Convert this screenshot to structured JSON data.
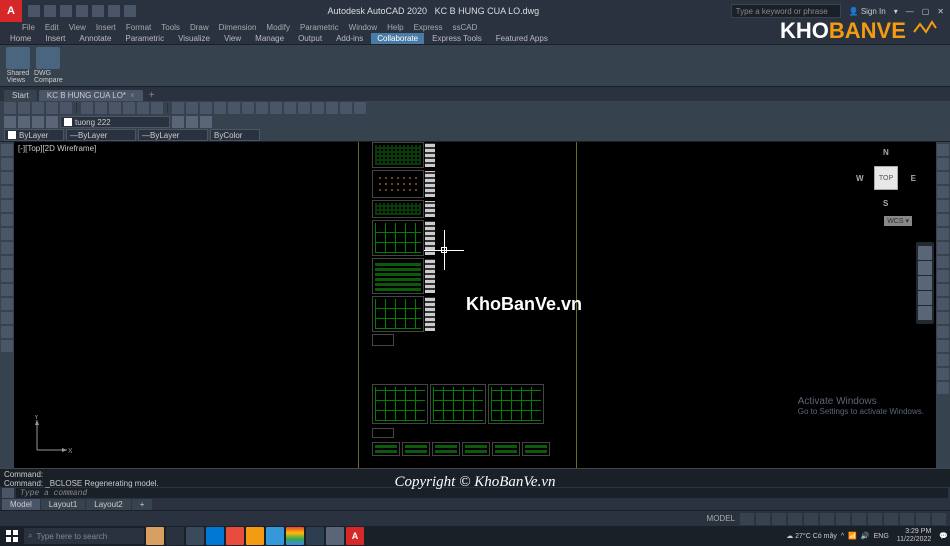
{
  "title": {
    "app": "Autodesk AutoCAD 2020",
    "file": "KC B HUNG CUA LO.dwg"
  },
  "search_placeholder": "Type a keyword or phrase",
  "signin": "Sign In",
  "menus": [
    "File",
    "Edit",
    "View",
    "Insert",
    "Format",
    "Tools",
    "Draw",
    "Dimension",
    "Modify",
    "Parametric",
    "Window",
    "Help",
    "Express",
    "ssCAD"
  ],
  "ribbon": {
    "tabs": [
      "Home",
      "Insert",
      "Annotate",
      "Parametric",
      "Visualize",
      "View",
      "Manage",
      "Output",
      "Add-ins",
      "Collaborate",
      "Express Tools",
      "Featured Apps"
    ],
    "active": "Collaborate",
    "items": [
      {
        "label": "Shared\nViews"
      },
      {
        "label": "DWG\nCompare"
      }
    ]
  },
  "filetabs": {
    "start": "Start",
    "open": "KC B HUNG CUA LO*"
  },
  "layer": {
    "current": "tuong 222",
    "combo1": "ByLayer",
    "combo2": "ByLayer",
    "combo3": "ByLayer",
    "combo4": "ByColor"
  },
  "view_label": "[-][Top][2D Wireframe]",
  "viewcube": {
    "top": "TOP",
    "n": "N",
    "e": "E",
    "s": "S",
    "w": "W",
    "wcs": "WCS"
  },
  "ucs": {
    "x": "X",
    "y": "Y"
  },
  "cmd": {
    "l1": "Command:",
    "l2": "Command: _BCLOSE Regenerating model.",
    "placeholder": "Type a command"
  },
  "layouts": [
    "Model",
    "Layout1",
    "Layout2"
  ],
  "status_model": "MODEL",
  "activate": {
    "t": "Activate Windows",
    "s": "Go to Settings to activate Windows."
  },
  "watermark": "KhoBanVe.vn",
  "logo": {
    "p1": "KHO",
    "p2": "BANVE"
  },
  "copyright": "Copyright © KhoBanVe.vn",
  "taskbar": {
    "search": "Type here to search",
    "weather_temp": "27°C",
    "weather_cond": "Có mây",
    "lang": "ENG",
    "time": "3:29 PM",
    "date": "11/22/2022"
  }
}
